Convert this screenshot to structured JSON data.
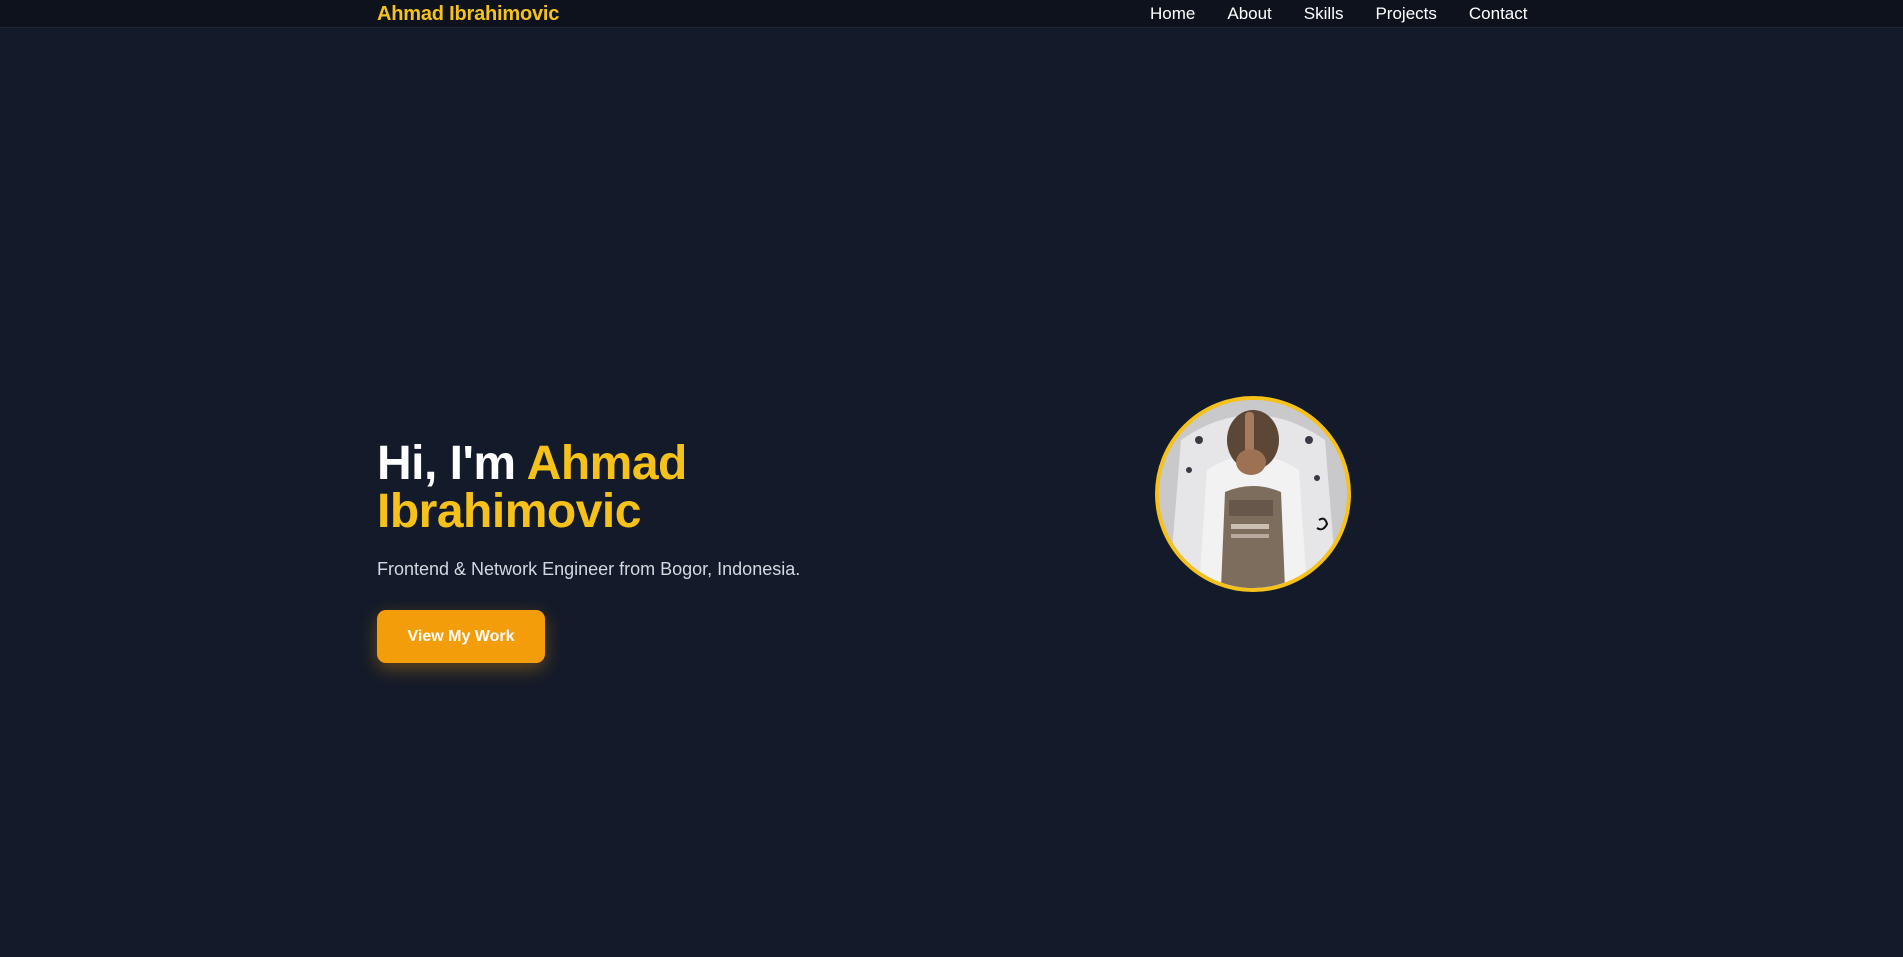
{
  "nav": {
    "brand": "Ahmad Ibrahimovic",
    "links": [
      {
        "label": "Home"
      },
      {
        "label": "About"
      },
      {
        "label": "Skills"
      },
      {
        "label": "Projects"
      },
      {
        "label": "Contact"
      }
    ]
  },
  "hero": {
    "greeting": "Hi, I'm ",
    "name": "Ahmad Ibrahimovic",
    "subtitle": "Frontend & Network Engineer from Bogor, Indonesia.",
    "cta_label": "View My Work"
  },
  "colors": {
    "background": "#131a29",
    "accent": "#f6c21a",
    "button": "#f49d0b"
  }
}
